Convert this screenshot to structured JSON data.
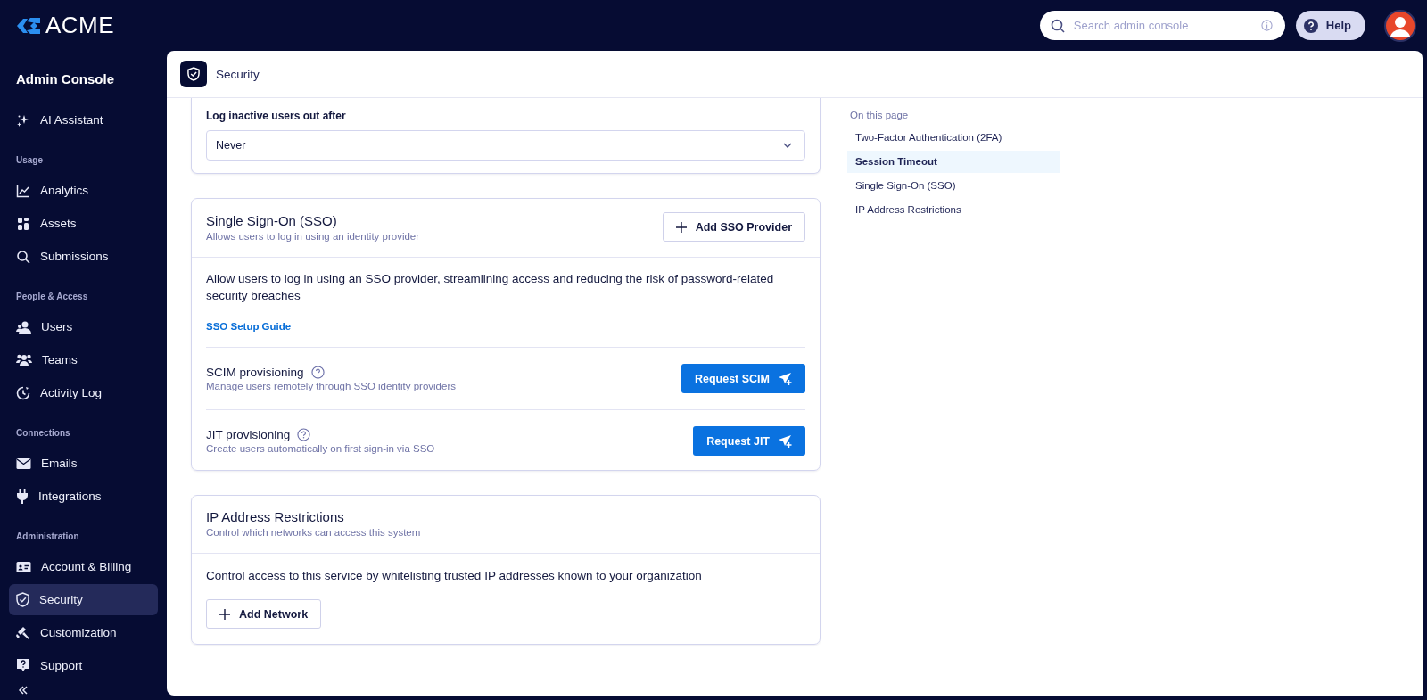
{
  "topbar": {
    "logo": "ACME",
    "search": {
      "placeholder": "Search admin console"
    },
    "help": "Help"
  },
  "sidebar": {
    "title": "Admin Console",
    "sections": [
      {
        "items": [
          {
            "label": "AI Assistant",
            "selected": false
          }
        ]
      },
      {
        "heading": "Usage",
        "items": [
          {
            "label": "Analytics",
            "selected": false
          },
          {
            "label": "Assets",
            "selected": false
          },
          {
            "label": "Submissions",
            "selected": false
          }
        ]
      },
      {
        "heading": "People & Access",
        "items": [
          {
            "label": "Users",
            "selected": false
          },
          {
            "label": "Teams",
            "selected": false
          },
          {
            "label": "Activity Log",
            "selected": false
          }
        ]
      },
      {
        "heading": "Connections",
        "items": [
          {
            "label": "Emails",
            "selected": false
          },
          {
            "label": "Integrations",
            "selected": false
          }
        ]
      },
      {
        "heading": "Administration",
        "items": [
          {
            "label": "Account & Billing",
            "selected": false
          },
          {
            "label": "Security",
            "selected": true
          },
          {
            "label": "Customization",
            "selected": false
          },
          {
            "label": "Support",
            "selected": false
          }
        ]
      }
    ]
  },
  "page": {
    "title": "Security"
  },
  "session": {
    "label": "Log inactive users out after",
    "value": "Never"
  },
  "sso": {
    "title": "Single Sign-On (SSO)",
    "subtitle": "Allows users to log in using an identity provider",
    "button": "Add SSO Provider",
    "text": "Allow users to log in using an SSO provider, streamlining access and reducing the risk of password-related security breaches",
    "link": "SSO Setup Guide",
    "rows": [
      {
        "title": "SCIM provisioning",
        "subtitle": "Manage users remotely through SSO identity providers",
        "button": "Request SCIM"
      },
      {
        "title": "JIT provisioning",
        "subtitle": "Create users automatically on first sign-in via SSO",
        "button": "Request JIT"
      }
    ]
  },
  "ip": {
    "title": "IP Address Restrictions",
    "subtitle": "Control which networks can access this system",
    "text": "Control access to this service by whitelisting trusted IP addresses known to your organization",
    "button": "Add Network"
  },
  "toc": {
    "title": "On this page",
    "items": [
      {
        "label": "Two-Factor Authentication (2FA)",
        "selected": false
      },
      {
        "label": "Session Timeout",
        "selected": true
      },
      {
        "label": "Single Sign-On (SSO)",
        "selected": false
      },
      {
        "label": "IP Address Restrictions",
        "selected": false
      }
    ]
  }
}
